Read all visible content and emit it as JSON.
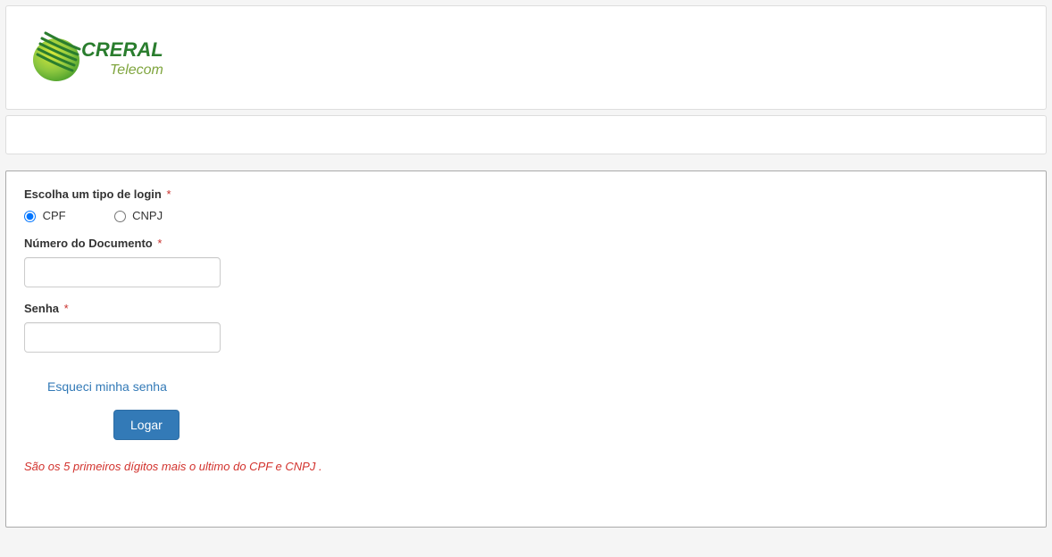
{
  "brand": {
    "name_main": "CRERAL",
    "name_sub": "Telecom"
  },
  "form": {
    "loginTypeLabel": "Escolha um tipo de login",
    "radios": {
      "cpf": "CPF",
      "cnpj": "CNPJ"
    },
    "docLabel": "Número do Documento",
    "docValue": "",
    "passLabel": "Senha",
    "passValue": "",
    "forgot": "Esqueci minha senha",
    "submit": "Logar",
    "hint": "São os 5 primeiros dígitos mais o ultimo do CPF e CNPJ ."
  }
}
